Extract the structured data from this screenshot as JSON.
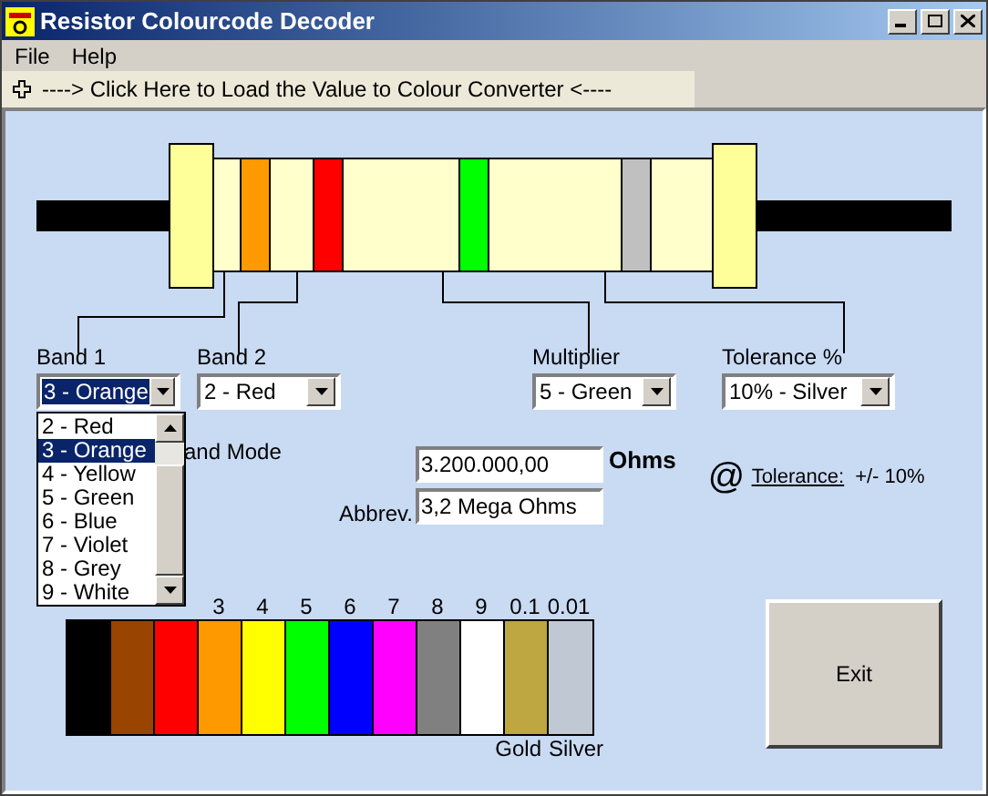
{
  "window": {
    "title": "Resistor Colourcode Decoder"
  },
  "menu": [
    "File",
    "Help"
  ],
  "toolbar": {
    "link": "----> Click Here to Load the Value to Colour Converter <----"
  },
  "resistor": {
    "bands": [
      {
        "color": "#ff9900"
      },
      {
        "color": "#ff0000"
      },
      {
        "color": "#00ff00"
      },
      {
        "color": "#c0c0c0"
      }
    ]
  },
  "selectors": [
    {
      "label": "Band 1",
      "value": "3 - Orange",
      "focused": true
    },
    {
      "label": "Band 2",
      "value": "2 - Red",
      "focused": false
    },
    {
      "label": "Multiplier",
      "value": "5 - Green",
      "focused": false
    },
    {
      "label": "Tolerance %",
      "value": "10% - Silver",
      "focused": false
    }
  ],
  "dropdown": [
    {
      "label": "2 - Red",
      "selected": false
    },
    {
      "label": "3 - Orange",
      "selected": true
    },
    {
      "label": "4 - Yellow",
      "selected": false
    },
    {
      "label": "5 - Green",
      "selected": false
    },
    {
      "label": "6 - Blue",
      "selected": false
    },
    {
      "label": "7 - Violet",
      "selected": false
    },
    {
      "label": "8 - Grey",
      "selected": false
    },
    {
      "label": "9 - White",
      "selected": false
    }
  ],
  "mode_label": "and Mode",
  "value": {
    "text": "3.200.000,00",
    "unit": "Ohms"
  },
  "abbrev": {
    "label": "Abbrev.",
    "text": "3,2 Mega Ohms"
  },
  "tolerance": {
    "symbol": "@",
    "link": "Tolerance:",
    "value": "+/- 10%"
  },
  "colour_chart": [
    {
      "color": "#000000"
    },
    {
      "color": "#994400"
    },
    {
      "color": "#ff0000"
    },
    {
      "digit": "3",
      "color": "#ff9900"
    },
    {
      "digit": "4",
      "color": "#ffff00"
    },
    {
      "digit": "5",
      "color": "#00ff00"
    },
    {
      "digit": "6",
      "color": "#0000ff"
    },
    {
      "digit": "7",
      "color": "#ff00ff"
    },
    {
      "digit": "8",
      "color": "#808080"
    },
    {
      "digit": "9",
      "color": "#ffffff"
    },
    {
      "digit": "0.1",
      "color": "#bea640",
      "name": "Gold"
    },
    {
      "digit": "0.01",
      "color": "#c0c8d4",
      "name": "Silver"
    }
  ],
  "exit_button": "Exit"
}
